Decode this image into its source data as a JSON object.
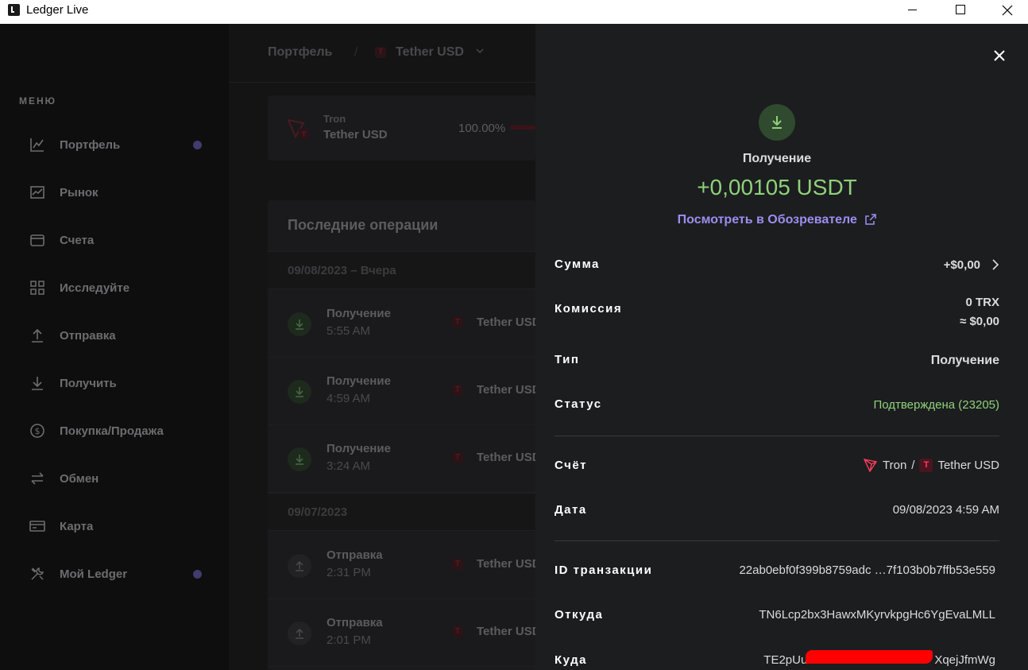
{
  "window": {
    "title": "Ledger Live"
  },
  "sidebar": {
    "menu_title": "МЕНЮ",
    "items": [
      {
        "label": "Портфель",
        "icon": "chart-line-icon",
        "dot": true
      },
      {
        "label": "Рынок",
        "icon": "market-icon",
        "dot": false
      },
      {
        "label": "Счета",
        "icon": "wallet-icon",
        "dot": false
      },
      {
        "label": "Исследуйте",
        "icon": "grid-icon",
        "dot": false
      },
      {
        "label": "Отправка",
        "icon": "arrow-up-icon",
        "dot": false
      },
      {
        "label": "Получить",
        "icon": "arrow-down-icon",
        "dot": false
      },
      {
        "label": "Покупка/Продажа",
        "icon": "dollar-icon",
        "dot": false
      },
      {
        "label": "Обмен",
        "icon": "swap-icon",
        "dot": false
      },
      {
        "label": "Карта",
        "icon": "card-icon",
        "dot": false
      },
      {
        "label": "Мой Ledger",
        "icon": "tools-icon",
        "dot": true
      }
    ]
  },
  "breadcrumb": {
    "portfolio": "Портфель",
    "separator": "/",
    "asset": "Tether USD"
  },
  "account_card": {
    "network": "Tron",
    "name": "Tether USD",
    "percent": "100.00%"
  },
  "operations": {
    "title": "Последние операции",
    "groups": [
      {
        "date": "09/08/2023 – Вчера",
        "items": [
          {
            "type": "Получение",
            "time": "5:55 AM",
            "asset": "Tether USD"
          },
          {
            "type": "Получение",
            "time": "4:59 AM",
            "asset": "Tether USD"
          },
          {
            "type": "Получение",
            "time": "3:24 AM",
            "asset": "Tether USD"
          }
        ]
      },
      {
        "date": "09/07/2023",
        "items": [
          {
            "type": "Отправка",
            "time": "2:31 PM",
            "asset": "Tether USD"
          },
          {
            "type": "Отправка",
            "time": "2:01 PM",
            "asset": "Tether USD"
          }
        ]
      }
    ]
  },
  "drawer": {
    "type": "Получение",
    "amount": "+0,00105 USDT",
    "explorer_link": "Посмотреть в Обозревателе",
    "rows": {
      "amount_label": "Сумма",
      "amount_value": "+$0,00",
      "fee_label": "Комиссия",
      "fee_value": "0 TRX",
      "fee_fiat": "≈ $0,00",
      "type_label": "Тип",
      "type_value": "Получение",
      "status_label": "Статус",
      "status_value": "Подтверждена (23205)",
      "account_label": "Счёт",
      "account_network": "Tron",
      "account_sep": "/",
      "account_name": "Tether USD",
      "date_label": "Дата",
      "date_value": "09/08/2023 4:59 AM",
      "txid_label": "ID транзакции",
      "txid_value": "22ab0ebf0f399b8759adc …7f103b0b7ffb53e559",
      "from_label": "Откуда",
      "from_value": "TN6Lcp2bx3HawxMKyrvkpgHc6YgEvaLMLL",
      "to_label": "Куда",
      "to_value_start": "TE2pUu",
      "to_value_end": "XqejJfmWg"
    }
  },
  "colors": {
    "positive": "#8fd17a",
    "link": "#9b8ef0",
    "tether": "#ff3b5c",
    "notification_dot": "#3f3c6e"
  }
}
